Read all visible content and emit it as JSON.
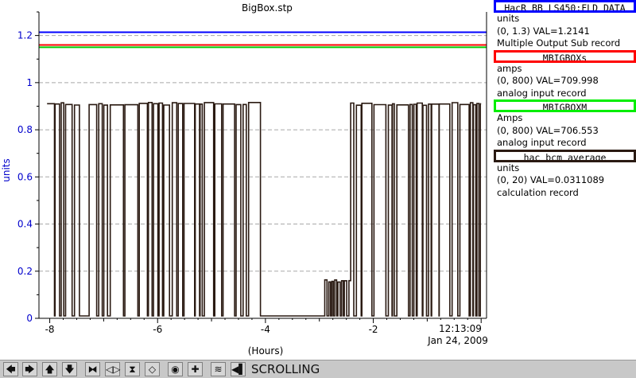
{
  "chart_data": {
    "type": "line",
    "title": "BigBox.stp",
    "ylabel": "units",
    "xlabel": "(Hours)",
    "x_ticks": [
      "-8",
      "-6",
      "-4",
      "-2"
    ],
    "y_ticks": [
      "0",
      "0.2",
      "0.4",
      "0.6",
      "0.8",
      "1",
      "1.2"
    ],
    "xlim": [
      -8.2,
      0.1
    ],
    "ylim": [
      0,
      1.3
    ],
    "time_label": "12:13:09",
    "date_label": "Jan 24, 2009",
    "grid": "horizontal dashed",
    "series": [
      {
        "name": "HacR_BB_LS450:FLD_DATA",
        "color": "#0000ff",
        "x": [
          -8.2,
          0.1
        ],
        "y": [
          1.2141,
          1.2141
        ]
      },
      {
        "name": "MBIGBOXs",
        "color": "#ff0000",
        "x": [
          -8.2,
          0.1
        ],
        "y": [
          1.16,
          1.16
        ]
      },
      {
        "name": "MBIGBOXM",
        "color": "#00cc00",
        "x": [
          -8.2,
          0.1
        ],
        "y": [
          1.15,
          1.15
        ]
      },
      {
        "name": "hac_bcm_average",
        "color": "#2a1a12",
        "segments": [
          {
            "type": "toggle",
            "x_range": [
              -8.05,
              -7.45
            ],
            "high": 0.91,
            "low": 0.01
          },
          {
            "type": "flat",
            "x": [
              -7.45,
              -7.27
            ],
            "y": 0.01
          },
          {
            "type": "toggle",
            "x_range": [
              -7.27,
              -4.05
            ],
            "high": 0.91,
            "low": 0.01
          },
          {
            "type": "flat",
            "x": [
              -4.05,
              -2.9
            ],
            "y": 0.01
          },
          {
            "type": "pulses",
            "x_range": [
              -2.9,
              -2.42
            ],
            "high": 0.16,
            "low": 0.01
          },
          {
            "type": "toggle",
            "x_range": [
              -2.42,
              0.0
            ],
            "high": 0.91,
            "low": 0.01
          }
        ]
      }
    ]
  },
  "legend": [
    {
      "name": "HacR_BB_LS450:FLD_DATA",
      "border": "#0000ff",
      "units": "units",
      "range": "(0, 1.3) VAL=1.2141",
      "type": "Multiple Output Sub record"
    },
    {
      "name": "MBIGBOXs",
      "border": "#ff0000",
      "units": "amps",
      "range": "(0, 800) VAL=709.998",
      "type": "analog input record"
    },
    {
      "name": "MBIGBOXM",
      "border": "#00ee00",
      "units": "Amps",
      "range": "(0, 800) VAL=706.553",
      "type": "analog input record"
    },
    {
      "name": "hac_bcm_average",
      "border": "#2a1a12",
      "units": "units",
      "range": "(0, 20) VAL=0.0311089",
      "type": "calculation record"
    }
  ],
  "toolbar": {
    "buttons": [
      {
        "icon": "arrow-left-icon",
        "glyph": "🡄",
        "name": "scroll-left-button"
      },
      {
        "icon": "arrow-right-icon",
        "glyph": "🡆",
        "name": "scroll-right-button"
      },
      {
        "icon": "arrow-up-icon",
        "glyph": "🡅",
        "name": "scroll-up-button"
      },
      {
        "icon": "arrow-down-icon",
        "glyph": "🡇",
        "name": "scroll-down-button"
      },
      {
        "icon": "zoom-in-horizontal-icon",
        "glyph": "⧓",
        "name": "zoom-in-x-button"
      },
      {
        "icon": "zoom-out-horizontal-icon",
        "glyph": "◁▷",
        "name": "zoom-out-x-button"
      },
      {
        "icon": "zoom-in-vertical-icon",
        "glyph": "⧗",
        "name": "zoom-in-y-button"
      },
      {
        "icon": "zoom-out-vertical-icon",
        "glyph": "◇",
        "name": "zoom-out-y-button"
      },
      {
        "icon": "autoscale-icon",
        "glyph": "◉",
        "name": "autoscale-button"
      },
      {
        "icon": "crosshair-icon",
        "glyph": "✚",
        "name": "crosshair-button"
      },
      {
        "icon": "show-all-icon",
        "glyph": "≋",
        "name": "show-all-button"
      },
      {
        "icon": "time-jump-icon",
        "glyph": "◀▌",
        "name": "jump-now-button"
      }
    ],
    "status": "SCROLLING"
  }
}
